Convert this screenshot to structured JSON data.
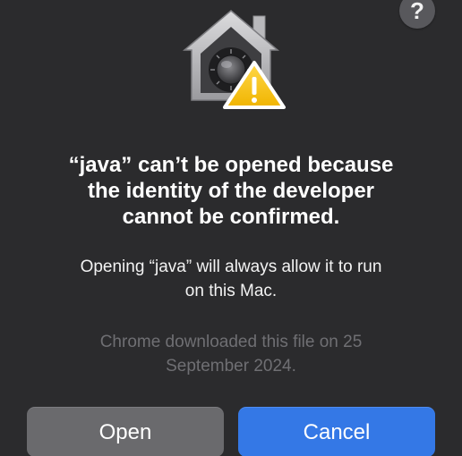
{
  "help_button": {
    "label": "?"
  },
  "icon": {
    "name": "gatekeeper-house-vault-warning-icon"
  },
  "dialog": {
    "title_lines": [
      "“java” can’t be opened because",
      "the identity of the developer",
      "cannot be confirmed."
    ],
    "message_lines": [
      "Opening “java” will always allow it to run",
      "on this Mac."
    ],
    "info_lines": [
      "Chrome downloaded this file on 25",
      "September 2024."
    ]
  },
  "buttons": {
    "open_label": "Open",
    "cancel_label": "Cancel"
  },
  "colors": {
    "background": "#2b2b2d",
    "primary_button": "#3478e6",
    "secondary_button": "#6a6a6d",
    "warning_yellow": "#f5c518"
  }
}
